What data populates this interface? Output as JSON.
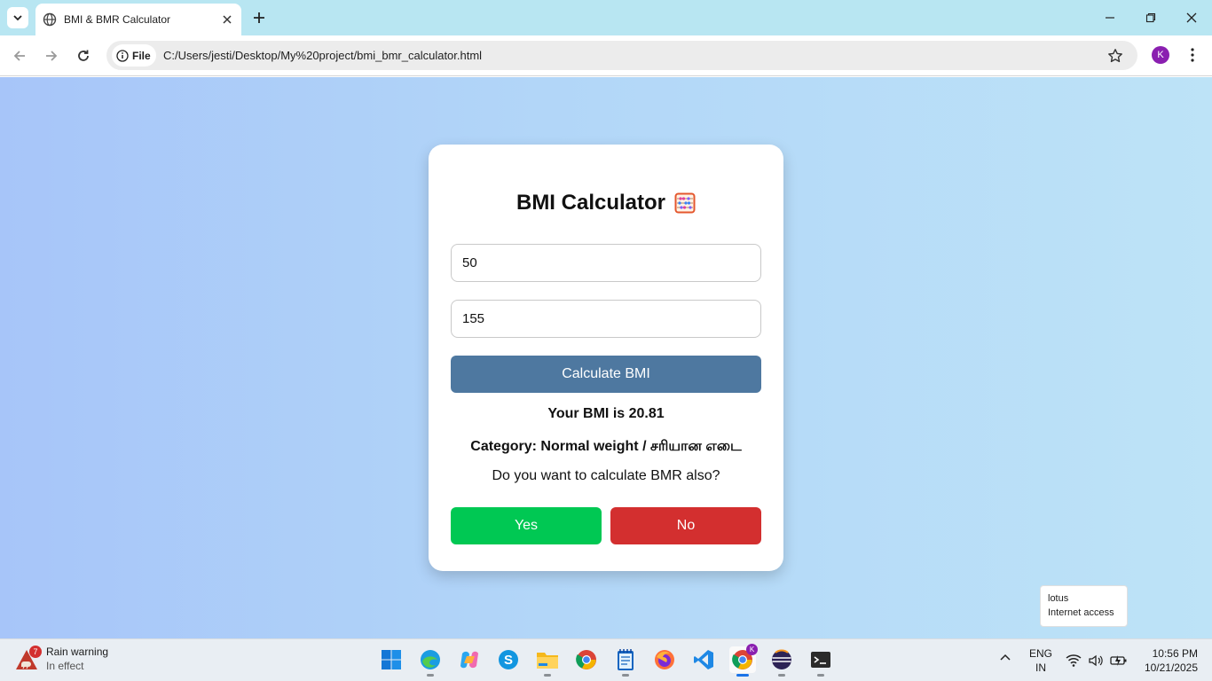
{
  "browser": {
    "tab_title": "BMI & BMR Calculator",
    "chip_label": "File",
    "url": "C:/Users/jesti/Desktop/My%20project/bmi_bmr_calculator.html",
    "profile_initial": "K"
  },
  "card": {
    "title": "BMI Calculator",
    "weight_value": "50",
    "height_value": "155",
    "calculate_label": "Calculate BMI",
    "bmi_result": "Your BMI is 20.81",
    "category_result": "Category: Normal weight / சரியான எடை",
    "bmr_question": "Do you want to calculate BMR also?",
    "yes_label": "Yes",
    "no_label": "No"
  },
  "network_toast": {
    "line1": "lotus",
    "line2": "Internet access"
  },
  "taskbar": {
    "weather_badge": "7",
    "weather_title": "Rain warning",
    "weather_sub": "In effect",
    "chrome_profile_badge": "K",
    "lang_line1": "ENG",
    "lang_line2": "IN",
    "time": "10:56 PM",
    "date": "10/21/2025"
  },
  "colors": {
    "calculate": "#4e78a0",
    "yes": "#00c853",
    "no": "#d32f2f"
  }
}
